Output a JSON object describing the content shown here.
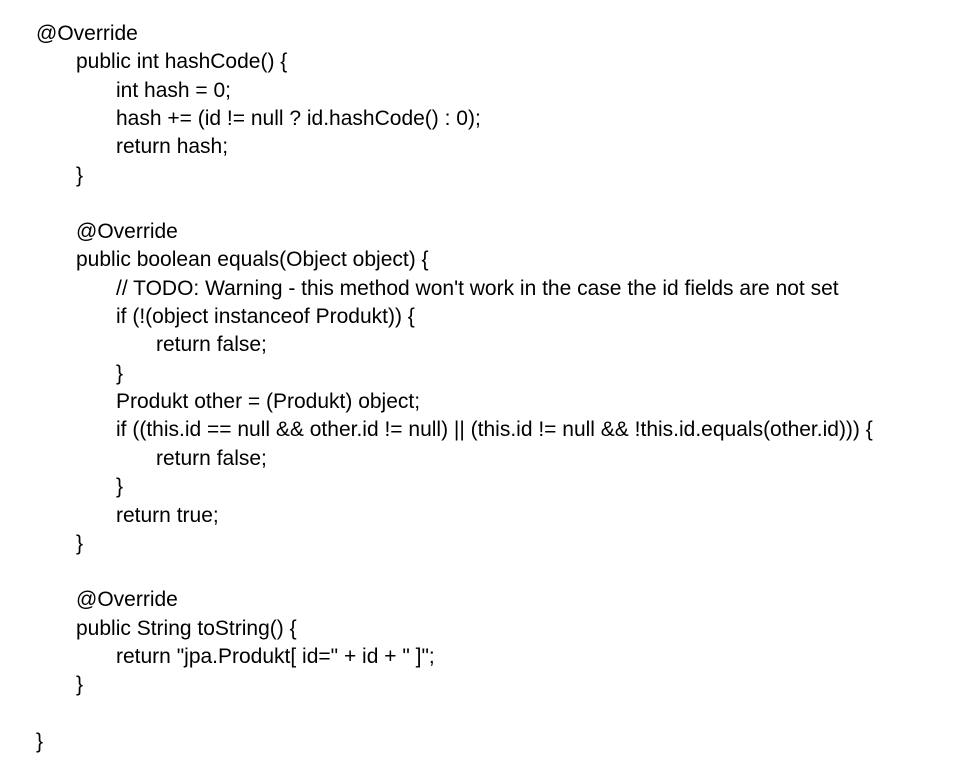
{
  "code": {
    "l1": "@Override",
    "l2": "public int hashCode() {",
    "l3": "int hash = 0;",
    "l4": "hash += (id != null ? id.hashCode() : 0);",
    "l5": "return hash;",
    "l6": "}",
    "l8": "@Override",
    "l9": "public boolean equals(Object object) {",
    "l10": "// TODO: Warning - this method won't work in the case the id fields are not set",
    "l11": "if (!(object instanceof Produkt)) {",
    "l12": "return false;",
    "l13": "}",
    "l14": "Produkt other = (Produkt) object;",
    "l15": "if ((this.id == null && other.id != null) || (this.id != null && !this.id.equals(other.id))) {",
    "l16": "return false;",
    "l17": "}",
    "l18": "return true;",
    "l19": "}",
    "l21": "@Override",
    "l22": "public String toString() {",
    "l23": "return \"jpa.Produkt[ id=\" + id + \" ]\";",
    "l24": "}",
    "l26": "}"
  }
}
